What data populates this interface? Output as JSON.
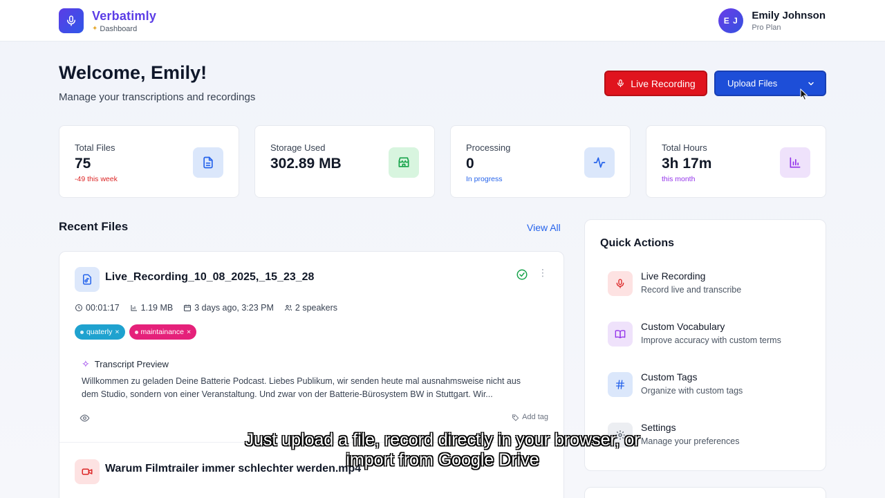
{
  "app": {
    "name": "Verbatimly",
    "section": "Dashboard",
    "colors": {
      "brand": "#5b3de6",
      "primary": "#1d4ed8",
      "danger": "#e0141e"
    }
  },
  "user": {
    "initials": "E J",
    "name": "Emily Johnson",
    "plan": "Pro Plan"
  },
  "welcome": {
    "title": "Welcome, Emily!",
    "subtitle": "Manage your transcriptions and recordings"
  },
  "actions": {
    "live_recording": "Live Recording",
    "upload_files": "Upload Files"
  },
  "stats": [
    {
      "label": "Total Files",
      "value": "75",
      "note": "-49 this week",
      "note_color": "#dc2626",
      "icon": "document-icon"
    },
    {
      "label": "Storage Used",
      "value": "302.89 MB",
      "note": "",
      "note_color": "#16a34a",
      "icon": "storage-icon"
    },
    {
      "label": "Processing",
      "value": "0",
      "note": "In progress",
      "note_color": "#2563eb",
      "icon": "activity-icon"
    },
    {
      "label": "Total Hours",
      "value": "3h 17m",
      "note": "this month",
      "note_color": "#9333ea",
      "icon": "bar-chart-icon"
    }
  ],
  "recent": {
    "title": "Recent Files",
    "view_all": "View All",
    "files": [
      {
        "name": "Live_Recording_10_08_2025,_15_23_28",
        "duration": "00:01:17",
        "size": "1.19 MB",
        "date": "3 days ago, 3:23 PM",
        "speakers": "2 speakers",
        "tags": [
          {
            "label": "quaterly",
            "color": "#1fa2cf"
          },
          {
            "label": "maintainance",
            "color": "#e5217a"
          }
        ],
        "preview_label": "Transcript Preview",
        "preview": "Willkommen zu geladen Deine Batterie Podcast. Liebes Publikum, wir senden heute mal ausnahmsweise nicht aus dem Studio, sondern von einer Veranstaltung. Und zwar von der Batterie-Bürosystem BW in Stuttgart. Wir...",
        "add_tag": "Add tag"
      },
      {
        "name": "Warum Filmtrailer immer schlechter werden.mp4"
      }
    ]
  },
  "quick_actions": {
    "title": "Quick Actions",
    "items": [
      {
        "label": "Live Recording",
        "desc": "Record live and transcribe",
        "icon": "microphone-icon"
      },
      {
        "label": "Custom Vocabulary",
        "desc": "Improve accuracy with custom terms",
        "icon": "book-icon"
      },
      {
        "label": "Custom Tags",
        "desc": "Organize with custom tags",
        "icon": "hash-icon"
      },
      {
        "label": "Settings",
        "desc": "Manage your preferences",
        "icon": "gear-icon"
      }
    ]
  },
  "caption": {
    "line1": "Just upload a file, record directly in your browser, or",
    "line2": "import from Google Drive"
  }
}
